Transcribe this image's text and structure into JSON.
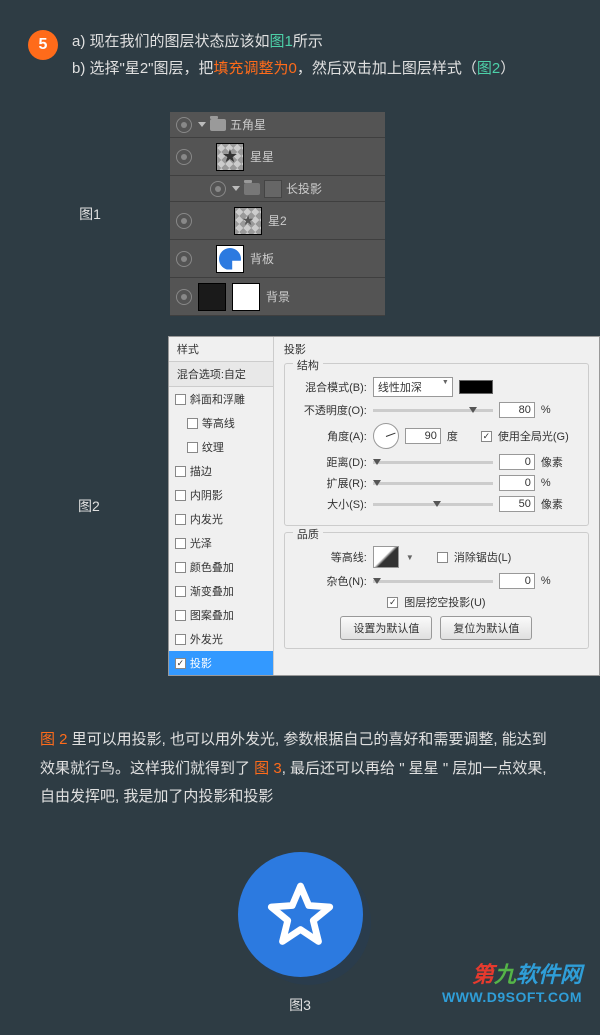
{
  "step": "5",
  "top": {
    "line_a_pre": "a) 现在我们的图层状态应该如",
    "line_a_hl": "图1",
    "line_a_post": "所示",
    "line_b_pre": "b) 选择\"星2\"图层，把",
    "line_b_hl1": "填充调整为0",
    "line_b_mid": "，然后双击加上图层样式（",
    "line_b_hl2": "图2",
    "line_b_post": "）"
  },
  "fig_labels": {
    "f1": "图1",
    "f2": "图2",
    "f3": "图3"
  },
  "layers": {
    "group": "五角星",
    "l_star": "星星",
    "l_longshadow": "长投影",
    "l_star2": "星2",
    "l_panel": "背板",
    "l_bg": "背景"
  },
  "dialog": {
    "styles_header": "样式",
    "blend_sub": "混合选项:自定",
    "items": {
      "bevel": "斜面和浮雕",
      "contour": "等高线",
      "texture": "纹理",
      "stroke": "描边",
      "innershadow": "内阴影",
      "innerglow": "内发光",
      "satin": "光泽",
      "coloroverlay": "颜色叠加",
      "gradoverlay": "渐变叠加",
      "patoverlay": "图案叠加",
      "outerglow": "外发光",
      "dropshadow": "投影"
    },
    "right_title": "投影",
    "structure_title": "结构",
    "quality_title": "品质",
    "labels": {
      "blendmode": "混合模式(B):",
      "opacity": "不透明度(O):",
      "angle": "角度(A):",
      "distance": "距离(D):",
      "spread": "扩展(R):",
      "size": "大小(S):",
      "contour_q": "等高线:",
      "noise": "杂色(N):",
      "global": "使用全局光(G)",
      "antialias": "消除锯齿(L)",
      "knockout": "图层挖空投影(U)"
    },
    "values": {
      "blendmode": "线性加深",
      "opacity": "80",
      "angle": "90",
      "distance": "0",
      "spread": "0",
      "size": "50",
      "noise": "0",
      "deg": "度",
      "px": "像素",
      "pct": "%"
    },
    "buttons": {
      "default_set": "设置为默认值",
      "default_reset": "复位为默认值"
    }
  },
  "bottom": {
    "hl1": "图 2",
    "t1": " 里可以用投影, 也可以用外发光, 参数根据自己的喜好和需要调整, 能达到效果就行鸟。这样我们就得到了 ",
    "hl2": "图 3",
    "t2": ", 最后还可以再给 \" 星星 \" 层加一点效果, 自由发挥吧, 我是加了内投影和投影"
  },
  "watermark": {
    "brand_chars": [
      "第",
      "九",
      "软",
      "件",
      "网"
    ],
    "url": "WWW.D9SOFT.COM"
  }
}
